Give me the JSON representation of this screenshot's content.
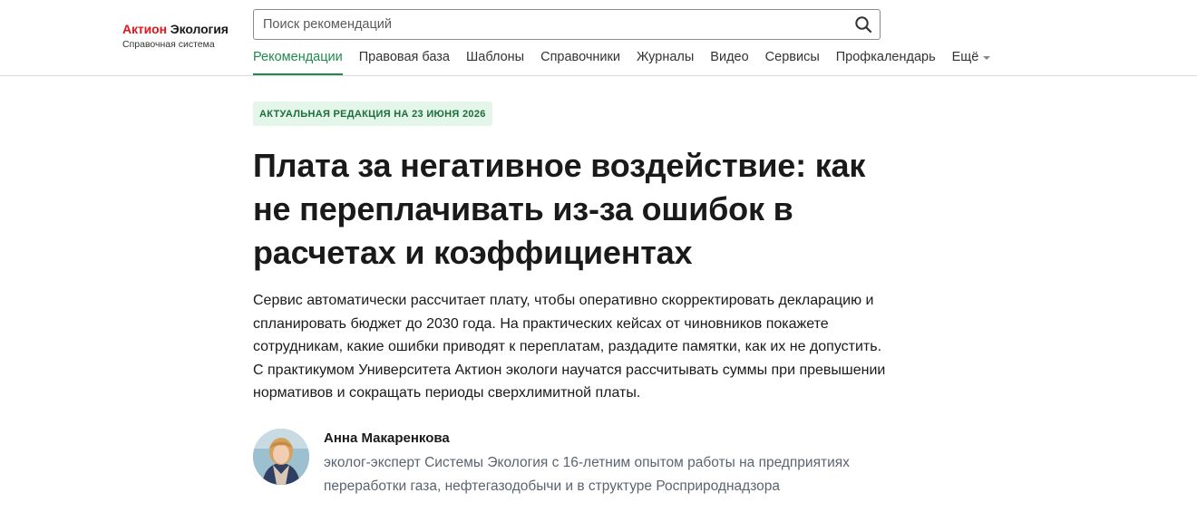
{
  "header": {
    "logo": {
      "brand": "Актион",
      "product": "Экология",
      "subtitle": "Справочная система"
    },
    "search": {
      "placeholder": "Поиск рекомендаций",
      "value": ""
    },
    "nav": {
      "items": [
        {
          "label": "Рекомендации",
          "active": true
        },
        {
          "label": "Правовая база",
          "active": false
        },
        {
          "label": "Шаблоны",
          "active": false
        },
        {
          "label": "Справочники",
          "active": false
        },
        {
          "label": "Журналы",
          "active": false
        },
        {
          "label": "Видео",
          "active": false
        },
        {
          "label": "Сервисы",
          "active": false
        },
        {
          "label": "Профкалендарь",
          "active": false
        }
      ],
      "more_label": "Ещё"
    }
  },
  "article": {
    "badge": "АКТУАЛЬНАЯ РЕДАКЦИЯ НА 23 ИЮНЯ 2026",
    "title": "Плата за негативное воздействие: как не переплачивать из-за ошибок в расчетах и коэффициентах",
    "lead": "Сервис автоматически рассчитает плату, чтобы оперативно скорректировать декларацию и спланировать бюджет до 2030 года. На практических кейсах от чиновников покажете сотрудникам, какие ошибки приводят к переплатам, раздадите памятки, как их не допустить. С практикумом Университета Актион экологи научатся рассчитывать суммы при превышении нормативов и сокращать периоды сверхлимитной платы.",
    "author": {
      "name": "Анна Макаренкова",
      "bio": "эколог-эксперт Системы Экология с 16-летним опытом работы на предприятиях переработки газа, нефтегазодобычи и в структуре Росприроднадзора"
    }
  },
  "colors": {
    "brand_red": "#e0161d",
    "accent_green": "#1f8a4c",
    "badge_bg": "#e3f6e9",
    "badge_text": "#1c6e3c"
  },
  "icons": {
    "search": "search-icon",
    "more": "chevron-down-icon"
  }
}
